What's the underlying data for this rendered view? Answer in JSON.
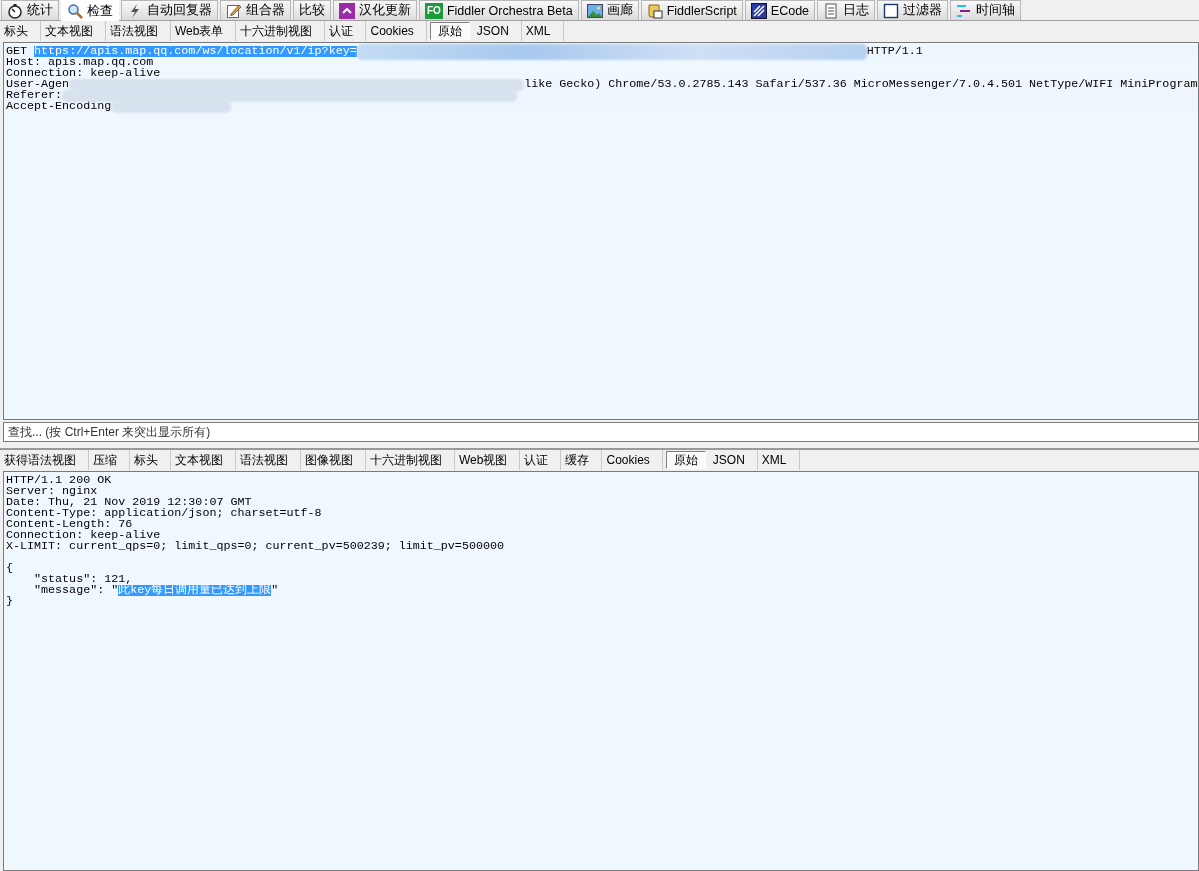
{
  "main_tabs": [
    {
      "label": "统计",
      "selected": false
    },
    {
      "label": "检查",
      "selected": true
    },
    {
      "label": "自动回复器",
      "selected": false
    },
    {
      "label": "组合器",
      "selected": false
    },
    {
      "label": "比较",
      "selected": false
    },
    {
      "label": "汉化更新",
      "selected": false
    },
    {
      "label": "Fiddler Orchestra Beta",
      "badge": "FO",
      "selected": false
    },
    {
      "label": "画廊",
      "selected": false
    },
    {
      "label": "FiddlerScript",
      "selected": false
    },
    {
      "label": "ECode",
      "selected": false
    },
    {
      "label": "日志",
      "selected": false
    },
    {
      "label": "过滤器",
      "selected": false
    },
    {
      "label": "时间轴",
      "selected": false
    }
  ],
  "request": {
    "tabs": [
      {
        "label": "标头",
        "selected": false
      },
      {
        "label": "文本视图",
        "selected": false
      },
      {
        "label": "语法视图",
        "selected": false
      },
      {
        "label": "Web表单",
        "selected": false
      },
      {
        "label": "十六进制视图",
        "selected": false
      },
      {
        "label": "认证",
        "selected": false
      },
      {
        "label": "Cookies",
        "selected": false
      },
      {
        "label": "原始",
        "selected": true
      },
      {
        "label": "JSON",
        "selected": false
      },
      {
        "label": "XML",
        "selected": false
      }
    ],
    "lines": [
      {
        "text": "GET ",
        "highlight": "https://apis.map.qq.com/ws/location/v1/ip?key=",
        "redacted": true,
        "tail": "HTTP/1.1"
      },
      {
        "text": "Host: apis.map.qq.com",
        "redacted": false
      },
      {
        "text": "Connection: keep-alive",
        "redacted": false
      },
      {
        "text": "User-Agen",
        "redacted": true,
        "tail": "like Gecko) Chrome/53.0.2785.143 Safari/537.36 MicroMessenger/7.0.4.501 NetType/WIFI MiniProgram"
      },
      {
        "text": "Referer:",
        "redacted": true
      },
      {
        "text": "Accept-Encoding",
        "redacted": true
      }
    ]
  },
  "find": {
    "placeholder": "查找... (按 Ctrl+Enter 来突出显示所有)"
  },
  "response": {
    "tabs": [
      {
        "label": "获得语法视图",
        "selected": false
      },
      {
        "label": "压缩",
        "selected": false
      },
      {
        "label": "标头",
        "selected": false
      },
      {
        "label": "文本视图",
        "selected": false
      },
      {
        "label": "语法视图",
        "selected": false
      },
      {
        "label": "图像视图",
        "selected": false
      },
      {
        "label": "十六进制视图",
        "selected": false
      },
      {
        "label": "Web视图",
        "selected": false
      },
      {
        "label": "认证",
        "selected": false
      },
      {
        "label": "缓存",
        "selected": false
      },
      {
        "label": "Cookies",
        "selected": false
      },
      {
        "label": "原始",
        "selected": true
      },
      {
        "label": "JSON",
        "selected": false
      },
      {
        "label": "XML",
        "selected": false
      }
    ],
    "lines": [
      {
        "text": "HTTP/1.1 200 OK"
      },
      {
        "text": "Server: nginx"
      },
      {
        "text": "Date: Thu, 21 Nov 2019 12:30:07 GMT"
      },
      {
        "text": "Content-Type: application/json; charset=utf-8"
      },
      {
        "text": "Content-Length: 76"
      },
      {
        "text": "Connection: keep-alive"
      },
      {
        "text": "X-LIMIT: current_qps=0; limit_qps=0; current_pv=500239; limit_pv=500000"
      }
    ],
    "body": [
      {
        "text": "{"
      },
      {
        "text": "    \"status\": 121,"
      },
      {
        "text": "    \"message\": \"",
        "highlight": "此key每日调用量已达到上限",
        "tail": "\""
      },
      {
        "text": "}"
      }
    ]
  }
}
